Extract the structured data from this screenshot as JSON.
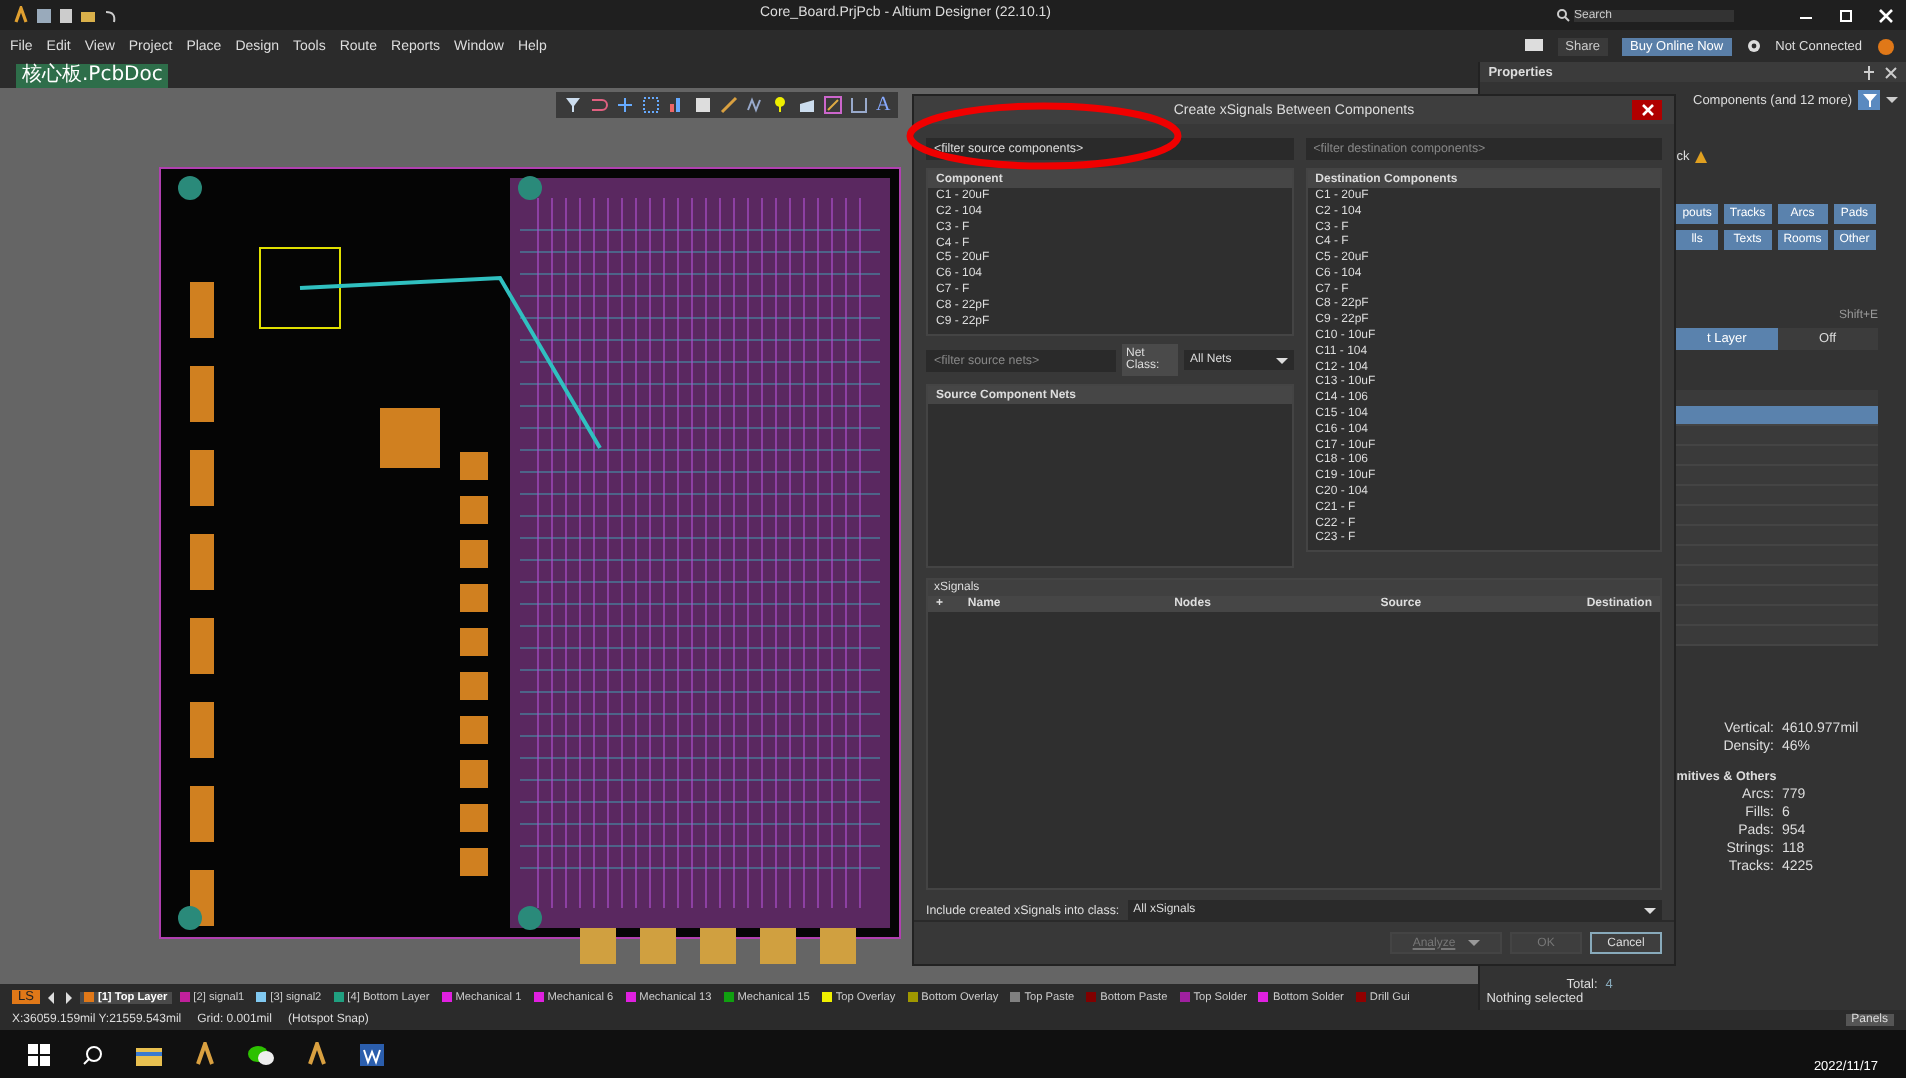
{
  "window": {
    "title": "Core_Board.PrjPcb - Altium Designer (22.10.1)",
    "search_placeholder": "Search"
  },
  "menu": [
    "File",
    "Edit",
    "View",
    "Project",
    "Place",
    "Design",
    "Tools",
    "Route",
    "Reports",
    "Window",
    "Help"
  ],
  "header_actions": {
    "share": "Share",
    "buy": "Buy Online Now",
    "connection": "Not Connected"
  },
  "document_tabs": [
    {
      "label": "核心板.PcbDoc",
      "selected": true
    }
  ],
  "toolbar": {
    "text_tool": "A"
  },
  "dialog": {
    "title": "Create xSignals Between Components",
    "source_filter_placeholder": "<filter source components>",
    "destination_filter_placeholder": "<filter destination components>",
    "source_header": "Component",
    "source_components": [
      "C1 - 20uF",
      "C2 - 104",
      "C3 - F",
      "C4 - F",
      "C5 - 20uF",
      "C6 - 104",
      "C7 - F",
      "C8 - 22pF",
      "C9 - 22pF"
    ],
    "nets_filter_placeholder": "<filter source nets>",
    "net_class_label": "Net Class:",
    "net_class_value": "All Nets",
    "nets_header": "Source Component Nets",
    "destination_header": "Destination Components",
    "destination_components": [
      "C1 - 20uF",
      "C2 - 104",
      "C3 - F",
      "C4 - F",
      "C5 - 20uF",
      "C6 - 104",
      "C7 - F",
      "C8 - 22pF",
      "C9 - 22pF",
      "C10 - 10uF",
      "C11 - 104",
      "C12 - 104",
      "C13 - 10uF",
      "C14 - 106",
      "C15 - 104",
      "C16 - 104",
      "C17 - 10uF",
      "C18 - 106",
      "C19 - 10uF",
      "C20 - 104",
      "C21 - F",
      "C22 - F",
      "C23 - F"
    ],
    "xsignals_title": "xSignals",
    "xsignals_columns": [
      "+",
      "Name",
      "Nodes",
      "Source",
      "Destination"
    ],
    "include_label": "Include created xSignals into class:",
    "include_value": "All xSignals",
    "buttons": [
      {
        "label": "Analyze",
        "disabled": true,
        "kind": "split"
      },
      {
        "label": "OK",
        "disabled": true,
        "kind": "plain"
      },
      {
        "label": "Cancel",
        "disabled": false,
        "kind": "plain"
      }
    ]
  },
  "properties_panel": {
    "title": "Properties",
    "filter_summary": "Components (and 12 more)",
    "tab_fragment": "ck",
    "object_buttons": [
      "pouts",
      "Tracks",
      "Arcs",
      "Pads",
      "lls",
      "Texts",
      "Rooms",
      "Other"
    ],
    "shortcut": "Shift+E",
    "layer_toggle": [
      {
        "label": "t Layer",
        "selected": true
      },
      {
        "label": "Off",
        "selected": false
      }
    ],
    "list_rows": [
      {
        "selected": true
      },
      {
        "selected": false
      },
      {
        "selected": false
      },
      {
        "selected": false
      },
      {
        "selected": false
      },
      {
        "selected": false
      },
      {
        "selected": false
      },
      {
        "selected": false
      },
      {
        "selected": false
      },
      {
        "selected": false
      },
      {
        "selected": false
      },
      {
        "selected": false
      }
    ],
    "stats": [
      {
        "label": "Vertical:",
        "value": "4610.977mil"
      },
      {
        "label": "Density:",
        "value": "46%"
      }
    ],
    "section": "mitives & Others",
    "counts": [
      {
        "label": "Arcs:",
        "value": "779"
      },
      {
        "label": "Fills:",
        "value": "6"
      },
      {
        "label": "Pads:",
        "value": "954"
      },
      {
        "label": "Strings:",
        "value": "118"
      },
      {
        "label": "Tracks:",
        "value": "4225"
      }
    ],
    "total": {
      "label": "Total:",
      "value": "4"
    },
    "selection": "Nothing selected"
  },
  "layer_bar": {
    "set_label": "LS",
    "layers": [
      {
        "label": "[1] Top Layer",
        "color": "#e07818",
        "selected": true
      },
      {
        "label": "[2] signal1",
        "color": "#c0209b",
        "selected": false
      },
      {
        "label": "[3] signal2",
        "color": "#80c8f0",
        "selected": false
      },
      {
        "label": "[4] Bottom Layer",
        "color": "#20a080",
        "selected": false
      },
      {
        "label": "Mechanical 1",
        "color": "#e020e0",
        "selected": false
      },
      {
        "label": "Mechanical 6",
        "color": "#e020e0",
        "selected": false
      },
      {
        "label": "Mechanical 13",
        "color": "#e020e0",
        "selected": false
      },
      {
        "label": "Mechanical 15",
        "color": "#10a010",
        "selected": false
      },
      {
        "label": "Top Overlay",
        "color": "#f0f000",
        "selected": false
      },
      {
        "label": "Bottom Overlay",
        "color": "#a09800",
        "selected": false
      },
      {
        "label": "Top Paste",
        "color": "#808080",
        "selected": false
      },
      {
        "label": "Bottom Paste",
        "color": "#800000",
        "selected": false
      },
      {
        "label": "Top Solder",
        "color": "#a020a0",
        "selected": false
      },
      {
        "label": "Bottom Solder",
        "color": "#e020e0",
        "selected": false
      },
      {
        "label": "Drill Gui",
        "color": "#900000",
        "selected": false
      }
    ]
  },
  "status_bar": {
    "coordinates": "X:36059.159mil Y:21559.543mil",
    "grid": "Grid: 0.001mil",
    "snap": "(Hotspot Snap)",
    "panels": "Panels"
  },
  "taskbar": {
    "date": "2022/11/17"
  }
}
